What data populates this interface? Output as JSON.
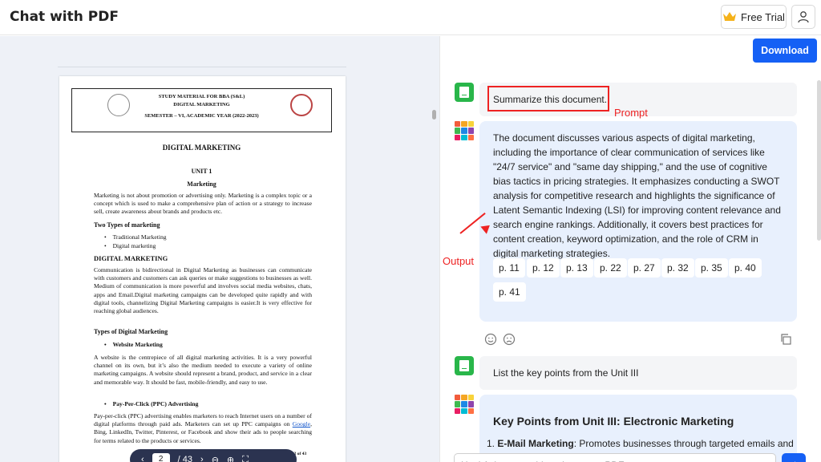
{
  "header": {
    "title": "Chat with PDF",
    "free_trial": "Free Trial"
  },
  "pdf": {
    "header_line1": "STUDY MATERIAL FOR BBA (S&L)",
    "header_line2": "DIGITAL MARKETING",
    "header_line3": "SEMESTER – VI, ACADEMIC YEAR (2022-2023)",
    "heading": "DIGITAL MARKETING",
    "unit": "UNIT 1",
    "subheading": "Marketing",
    "para1": "Marketing is not about promotion or advertising only. Marketing is a complex topic or a concept which is used to make a comprehensive plan of action or a strategy to increase sell, create awareness about brands and products etc.",
    "types_heading": "Two Types of marketing",
    "bullet1": "Traditional Marketing",
    "bullet2": "Digital marketing",
    "dm_heading": "DIGITAL MARKETING",
    "para2": "Communication is bidirectional in Digital Marketing as businesses can communicate with customers and customers can ask queries or make suggestions to businesses as well. Medium of communication is more powerful and involves social media websites, chats, apps and Email.Digital marketing campaigns can be developed quite rapidly and with digital tools, channelizing Digital Marketing campaigns is easier.It is very effective for reaching global audiences.",
    "types_dm": "Types of Digital Marketing",
    "website_heading": "Website Marketing",
    "para3": "A website is the centrepiece of all digital marketing activities. It is a very powerful channel on its own, but it’s also the medium needed to execute a variety of online marketing campaigns. A website should represent a brand, product, and service in a clear and memorable way. It should be fast, mobile-friendly, and easy to use.",
    "ppc_heading": "Pay-Per-Click (PPC) Advertising",
    "para4_a": "Pay-per-click (PPC) advertising enables marketers to reach Internet users on a number of digital platforms through paid ads. Marketers can set up PPC campaigns on ",
    "para4_link": "Google",
    "para4_b": ", Bing, LinkedIn, Twitter, Pinterest, or Facebook and show their ads to people searching for terms related to the products or services.",
    "page_footer": "Page 2 of 43",
    "toolbar_page": "2",
    "toolbar_total": "/ 43"
  },
  "chat": {
    "download": "Download",
    "user_msg1": "Summarize this document.",
    "bot_msg1": "The document discusses various aspects of digital marketing, including the importance of clear communication of services like \"24/7 service\" and \"same day shipping,\" and the use of cognitive bias tactics in pricing strategies. It emphasizes conducting a SWOT analysis for competitive research and highlights the significance of Latent Semantic Indexing (LSI) for improving content relevance and search engine rankings. Additionally, it covers best practices for content creation, keyword optimization, and the role of CRM in digital marketing strategies.",
    "chips": [
      "p. 11",
      "p. 12",
      "p. 13",
      "p. 22",
      "p. 27",
      "p. 32",
      "p. 35",
      "p. 40",
      "p. 41"
    ],
    "user_msg2": "List the key points from the Unit III",
    "bot_msg2_title": "Key Points from Unit III: Electronic Marketing",
    "bot_msg2_item_bold": "E-Mail Marketing",
    "bot_msg2_item_rest": ": Promotes businesses through targeted emails and",
    "input_placeholder": "Hey! Ask me anything about your PDF"
  },
  "annotations": {
    "prompt": "Prompt",
    "output": "Output"
  },
  "colors": {
    "accent": "#1560f5",
    "annotation": "#e22222",
    "user_avatar": "#29b64a"
  }
}
